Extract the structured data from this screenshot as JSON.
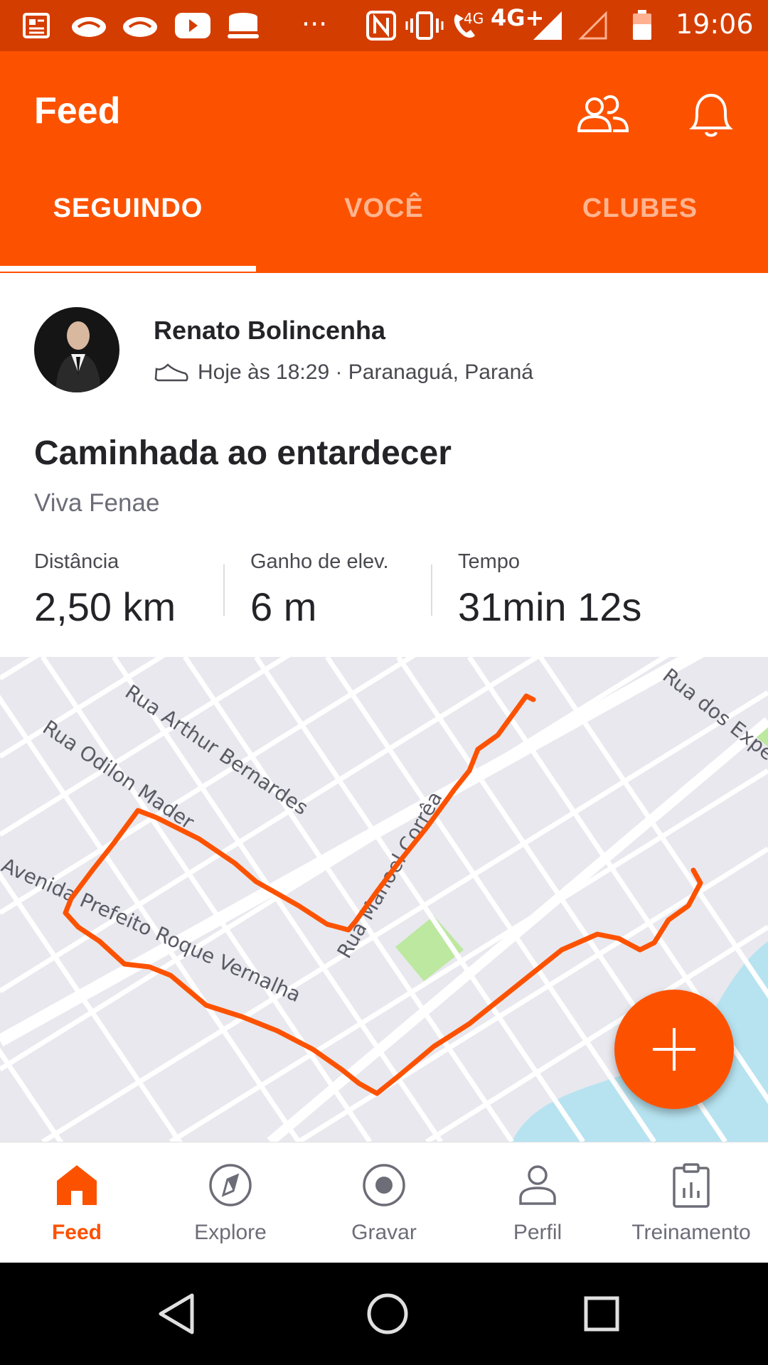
{
  "status_bar": {
    "time": "19:06",
    "network": "4G+",
    "network_small": "4G",
    "more": "···",
    "colors": {
      "background": "#d43d00"
    }
  },
  "header": {
    "title": "Feed",
    "colors": {
      "background": "#fc5200"
    }
  },
  "tabs": [
    {
      "label": "SEGUINDO",
      "active": true
    },
    {
      "label": "VOCÊ",
      "active": false
    },
    {
      "label": "CLUBES",
      "active": false
    }
  ],
  "activity": {
    "athlete_name": "Renato Bolincenha",
    "meta": "Hoje às 18:29 · Paranaguá, Paraná",
    "sport_icon": "shoe-icon",
    "title": "Caminhada ao entardecer",
    "description": "Viva Fenae",
    "stats": [
      {
        "label": "Distância",
        "value": "2,50 km"
      },
      {
        "label": "Ganho de elev.",
        "value": "6 m"
      },
      {
        "label": "Tempo",
        "value": "31min 12s"
      }
    ]
  },
  "map": {
    "street_labels": [
      "Rua Arthur Bernardes",
      "Rua Odilon Mader",
      "Avenida Prefeito Roque Vernalha",
      "Rua Manoel Corrêa",
      "Rua dos Expe"
    ],
    "colors": {
      "route": "#fc5200",
      "park": "#bde8a0",
      "water": "#a8dff0"
    }
  },
  "fab": {
    "icon": "plus-icon"
  },
  "bottom_nav": [
    {
      "label": "Feed",
      "icon": "home-icon",
      "active": true
    },
    {
      "label": "Explore",
      "icon": "compass-icon",
      "active": false
    },
    {
      "label": "Gravar",
      "icon": "record-icon",
      "active": false
    },
    {
      "label": "Perfil",
      "icon": "person-icon",
      "active": false
    },
    {
      "label": "Treinamento",
      "icon": "clipboard-chart-icon",
      "active": false
    }
  ]
}
